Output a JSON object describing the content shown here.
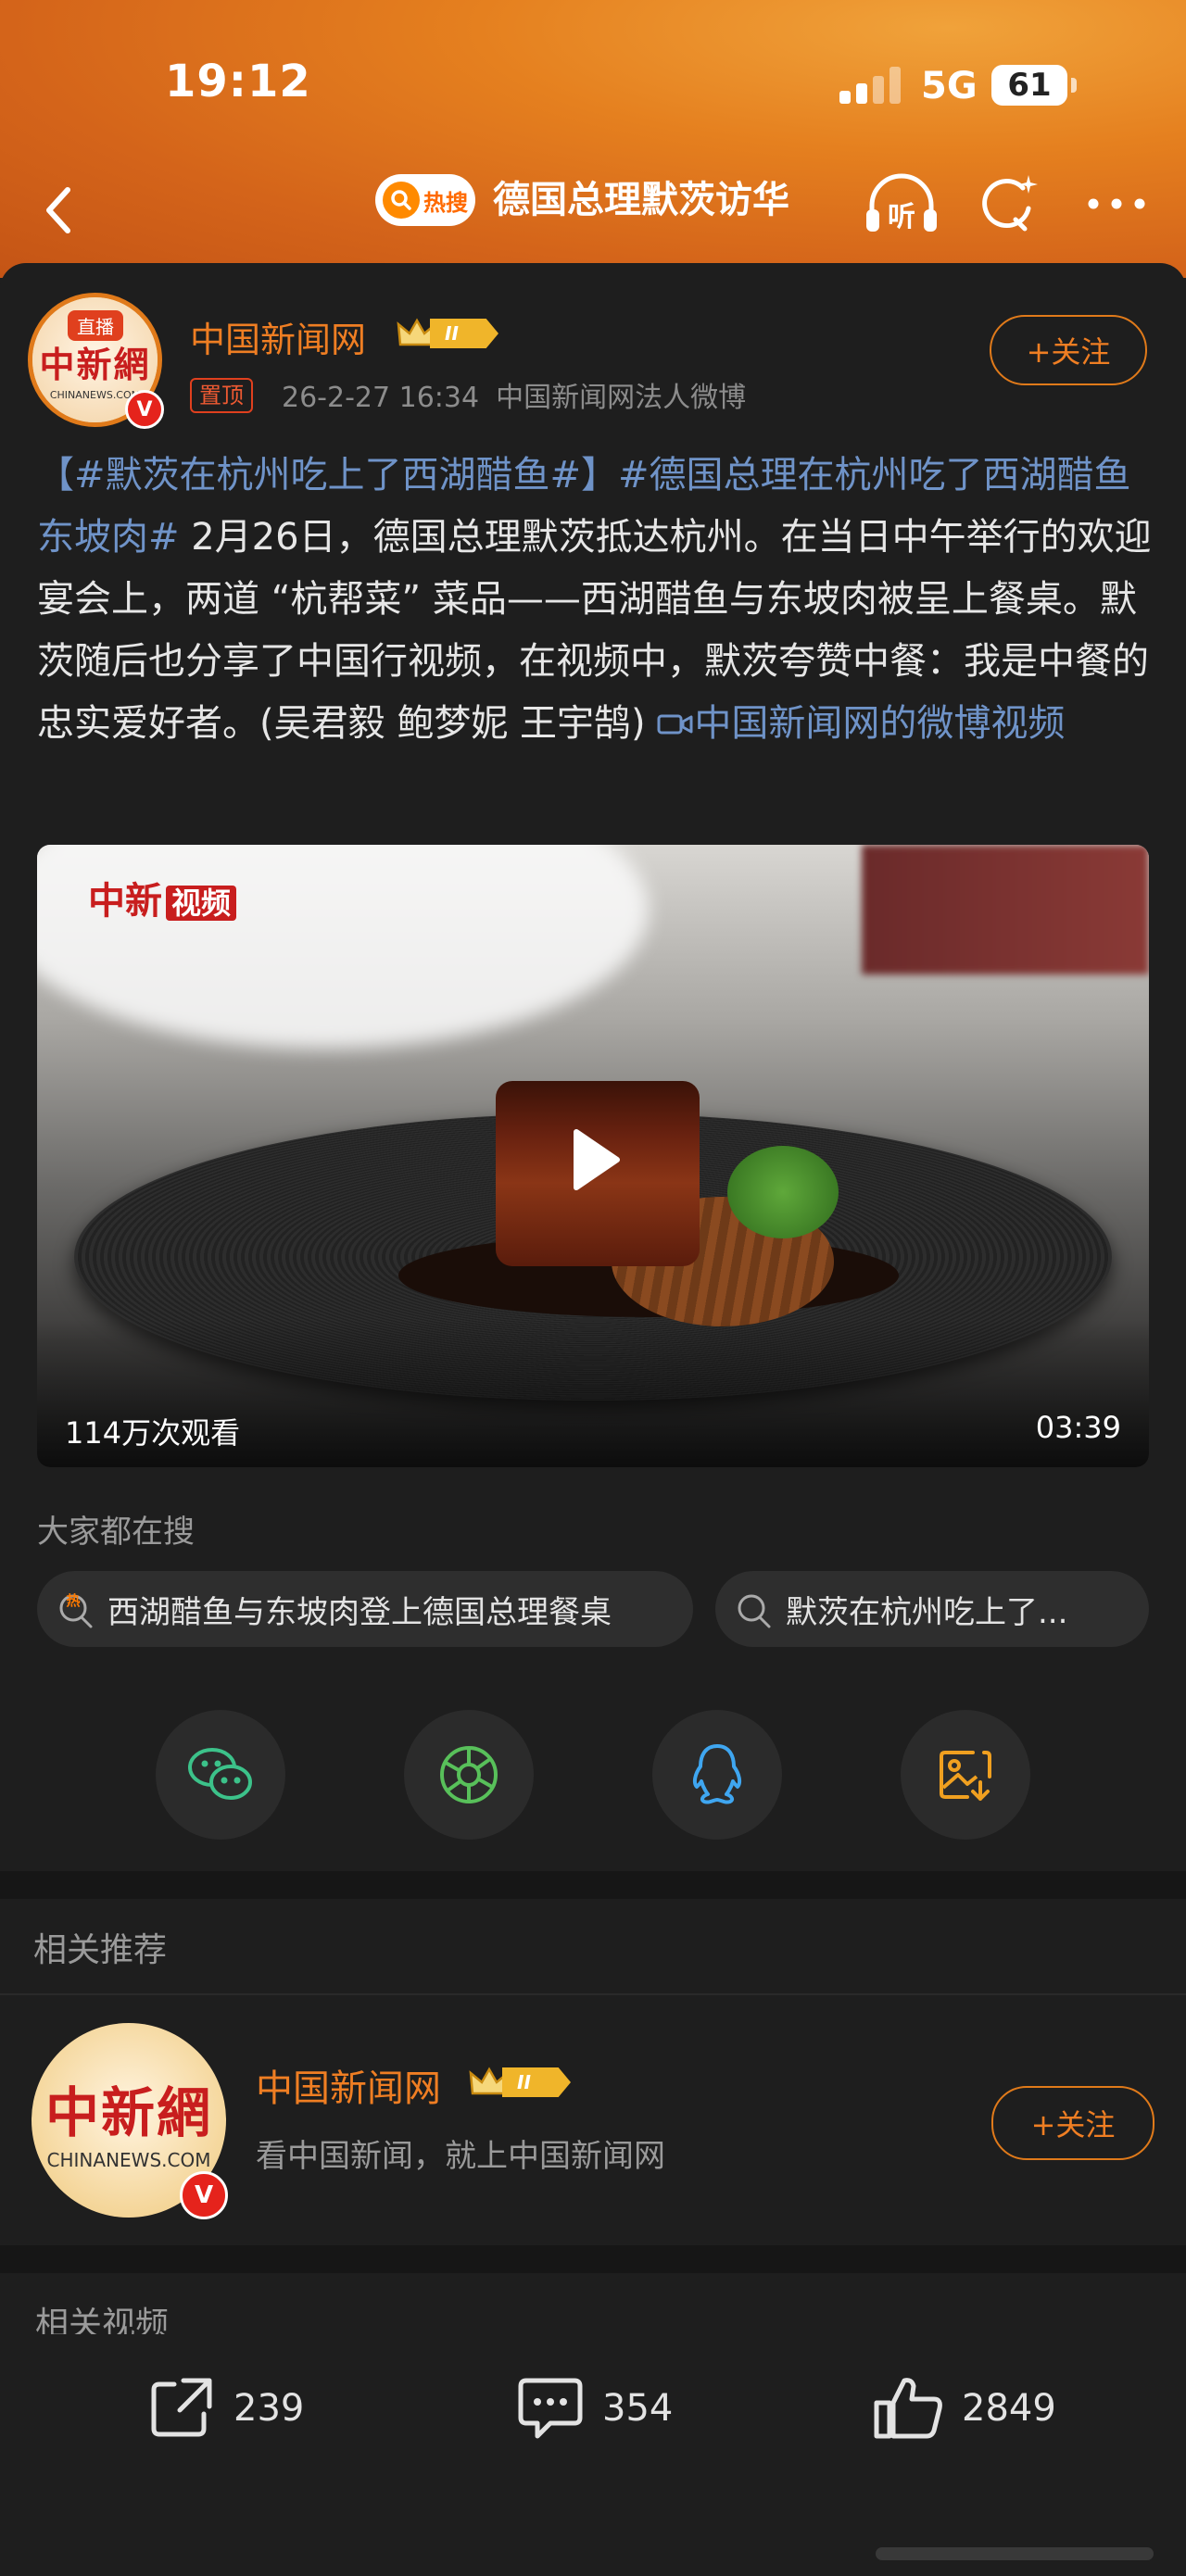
{
  "status_bar": {
    "time": "19:12",
    "network": "5G",
    "battery": "61",
    "battery_level": 0.61
  },
  "nav": {
    "hot_badge": "热搜",
    "title": "德国总理默茨访华",
    "listen_label": "听"
  },
  "post": {
    "author": "中国新闻网",
    "avatar_live_tag": "直播",
    "avatar_logo_text": "中新網",
    "avatar_logo_en": "CHINANEWS.COM",
    "verified_badge": "V",
    "level_badge": "II",
    "pinned_label": "置顶",
    "timestamp": "26-2-27 16:34",
    "source": "中国新闻网法人微博",
    "follow_label": "+关注",
    "tag1": "【#默茨在杭州吃上了西湖醋鱼#】",
    "tag2": "#德国总理在杭州吃了西湖醋鱼东坡肉#",
    "body": " 2月26日，德国总理默茨抵达杭州。在当日中午举行的欢迎宴会上，两道 “杭帮菜” 菜品——西湖醋鱼与东坡肉被呈上餐桌。默茨随后也分享了中国行视频，在视频中，默茨夸赞中餐：我是中餐的忠实爱好者。(吴君毅 鲍梦妮 王宇鹄) ",
    "video_link_text": "中国新闻网的微博视频"
  },
  "video": {
    "watermark": "中新",
    "watermark_suffix": "视频",
    "views": "114万次观看",
    "duration": "03:39"
  },
  "search": {
    "title": "大家都在搜",
    "chips": [
      "西湖醋鱼与东坡肉登上德国总理餐桌",
      "默茨在杭州吃上了..."
    ],
    "hot_mark": "热"
  },
  "share_icons": [
    "wechat-icon",
    "moments-icon",
    "qq-icon",
    "save-image-icon"
  ],
  "related": {
    "recommend_title": "相关推荐",
    "account_name": "中国新闻网",
    "account_desc": "看中国新闻，就上中国新闻网",
    "follow_label": "+关注",
    "video_title": "相关视频"
  },
  "actions": {
    "reposts": "239",
    "comments": "354",
    "likes": "2849"
  },
  "colors": {
    "accent": "#ef7e23",
    "link": "#6f93c8",
    "background": "#1e1e1e"
  }
}
